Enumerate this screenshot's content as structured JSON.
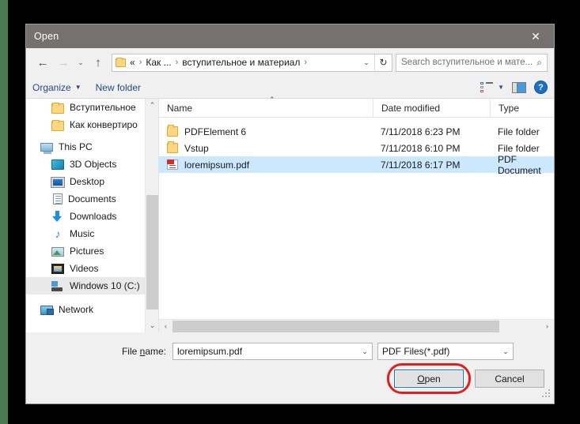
{
  "window": {
    "title": "Open",
    "close_label": "✕"
  },
  "nav": {
    "back_icon": "←",
    "forward_icon": "→",
    "recent_icon": "⌄",
    "up_icon": "↑",
    "address": {
      "folder_icon": "folder-icon",
      "crumbs": [
        "«",
        "Как ...",
        "вступительное и материал"
      ],
      "separator": "›",
      "dropdown_icon": "⌄",
      "refresh_icon": "↻"
    },
    "search": {
      "placeholder": "Search вступительное и мате...",
      "icon": "⌕"
    }
  },
  "toolbar": {
    "organize_label": "Organize",
    "organize_caret": "▼",
    "new_folder_label": "New folder",
    "view_caret": "▼",
    "help_label": "?"
  },
  "sidebar": {
    "items": [
      {
        "label": "Вступительное",
        "icon": "folder-icon",
        "indent": 1,
        "selected": false
      },
      {
        "label": "Как конвертиро",
        "icon": "folder-icon",
        "indent": 1,
        "selected": false
      },
      {
        "label": "This PC",
        "icon": "this-pc-icon",
        "indent": 0,
        "selected": false
      },
      {
        "label": "3D Objects",
        "icon": "3d-objects-icon",
        "indent": 1,
        "selected": false
      },
      {
        "label": "Desktop",
        "icon": "desktop-icon",
        "indent": 1,
        "selected": false
      },
      {
        "label": "Documents",
        "icon": "documents-icon",
        "indent": 1,
        "selected": false
      },
      {
        "label": "Downloads",
        "icon": "downloads-icon",
        "indent": 1,
        "selected": false
      },
      {
        "label": "Music",
        "icon": "music-icon",
        "indent": 1,
        "selected": false
      },
      {
        "label": "Pictures",
        "icon": "pictures-icon",
        "indent": 1,
        "selected": false
      },
      {
        "label": "Videos",
        "icon": "videos-icon",
        "indent": 1,
        "selected": false
      },
      {
        "label": "Windows 10 (C:)",
        "icon": "drive-icon",
        "indent": 1,
        "selected": true
      },
      {
        "label": "Network",
        "icon": "network-icon",
        "indent": 0,
        "selected": false
      }
    ],
    "scroll_up_icon": "⌃",
    "scroll_down_icon": "⌄"
  },
  "filelist": {
    "columns": [
      "Name",
      "Date modified",
      "Type"
    ],
    "sort_caret": "⌃",
    "rows": [
      {
        "name": "PDFElement 6",
        "date": "7/11/2018 6:23 PM",
        "type": "File folder",
        "icon": "folder-icon",
        "selected": false
      },
      {
        "name": "Vstup",
        "date": "7/11/2018 6:10 PM",
        "type": "File folder",
        "icon": "folder-icon",
        "selected": false
      },
      {
        "name": "loremipsum.pdf",
        "date": "7/11/2018 6:17 PM",
        "type": "PDF Document",
        "icon": "pdf-icon",
        "selected": true
      }
    ],
    "hscroll_left_icon": "‹",
    "hscroll_right_icon": "›"
  },
  "footer": {
    "filename_label": "File name:",
    "filename_value": "loremipsum.pdf",
    "filename_dropdown_icon": "⌄",
    "filetype_value": "PDF Files(*.pdf)",
    "filetype_dropdown_icon": "⌄",
    "open_label": "Open",
    "cancel_label": "Cancel"
  },
  "colors": {
    "titlebar": "#767170",
    "selection": "#cce8ff",
    "accent": "#0078d7",
    "annotation": "#e31c1c",
    "toolbar_link": "#24497f"
  }
}
